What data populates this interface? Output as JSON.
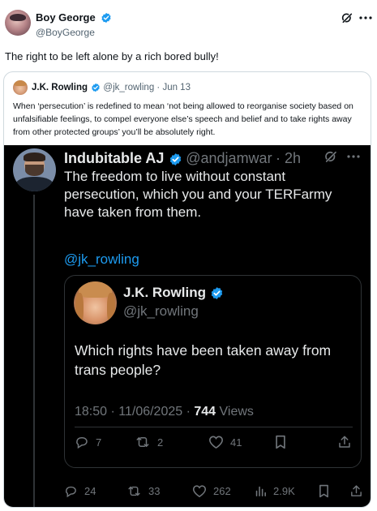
{
  "outer": {
    "author_name": "Boy George",
    "author_handle": "@BoyGeorge",
    "text": "The right to be left alone by a rich bored bully!"
  },
  "quote1": {
    "author_name": "J.K. Rowling",
    "author_handle": "@jk_rowling",
    "date": "· Jun 13",
    "text": "When ‘persecution’ is redefined to mean ‘not being allowed to reorganise society based on unfalsifiable feelings, to compel everyone else’s speech and belief and to take rights away from other protected groups’ you’ll be absolutely right."
  },
  "dark_post": {
    "author_name": "Indubitable AJ",
    "author_handle": "@andjamwar",
    "time": "· 2h",
    "text": "The freedom to live without constant persecution, which you and your TERFarmy have taken from them.",
    "mention": "@jk_rowling",
    "inner_quote": {
      "author_name": "J.K. Rowling",
      "author_handle": "@jk_rowling",
      "text": "Which rights have been taken away from trans people?",
      "timestamp": "18:50 · 11/06/2025 · ",
      "views_count": "744",
      "views_label": " Views",
      "replies": "7",
      "reposts": "2",
      "likes": "41"
    },
    "actions": {
      "replies": "24",
      "reposts": "33",
      "likes": "262",
      "views": "2.9K"
    }
  },
  "colors": {
    "verified_blue": "#1d9bf0",
    "dark_bg": "#000000",
    "dark_border": "#2f3336",
    "dark_muted": "#71767b",
    "link": "#1d9bf0"
  }
}
